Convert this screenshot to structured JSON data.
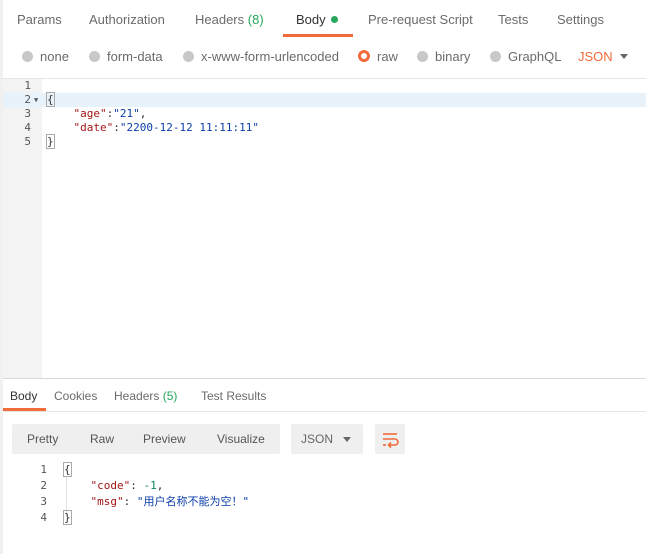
{
  "request_tabs": {
    "params": "Params",
    "authorization": "Authorization",
    "headers": "Headers",
    "headers_count": "(8)",
    "body": "Body",
    "prerequest": "Pre-request Script",
    "tests": "Tests",
    "settings": "Settings"
  },
  "body_types": {
    "none": "none",
    "form_data": "form-data",
    "urlencoded": "x-www-form-urlencoded",
    "raw": "raw",
    "binary": "binary",
    "graphql": "GraphQL",
    "language": "JSON",
    "selected": "raw"
  },
  "request_editor": {
    "line_numbers": [
      "1",
      "2",
      "3",
      "4",
      "5"
    ],
    "open_brace": "{",
    "age_key": "\"age\"",
    "age_value": "\"21\"",
    "date_key": "\"date\"",
    "date_value": "\"2200-12-12 11:11:11\"",
    "close_brace": "}"
  },
  "response_tabs": {
    "body": "Body",
    "cookies": "Cookies",
    "headers": "Headers",
    "headers_count": "(5)",
    "test_results": "Test Results"
  },
  "response_view": {
    "pretty": "Pretty",
    "raw": "Raw",
    "preview": "Preview",
    "visualize": "Visualize",
    "format": "JSON"
  },
  "response_editor": {
    "line_numbers": [
      "1",
      "2",
      "3",
      "4"
    ],
    "open_brace": "{",
    "code_key": "\"code\"",
    "code_value": "-1",
    "msg_key": "\"msg\"",
    "msg_value": "\"用户名称不能为空！\"",
    "close_brace": "}"
  },
  "colors": {
    "accent": "#f26b3a",
    "count_green": "#26a65b"
  }
}
